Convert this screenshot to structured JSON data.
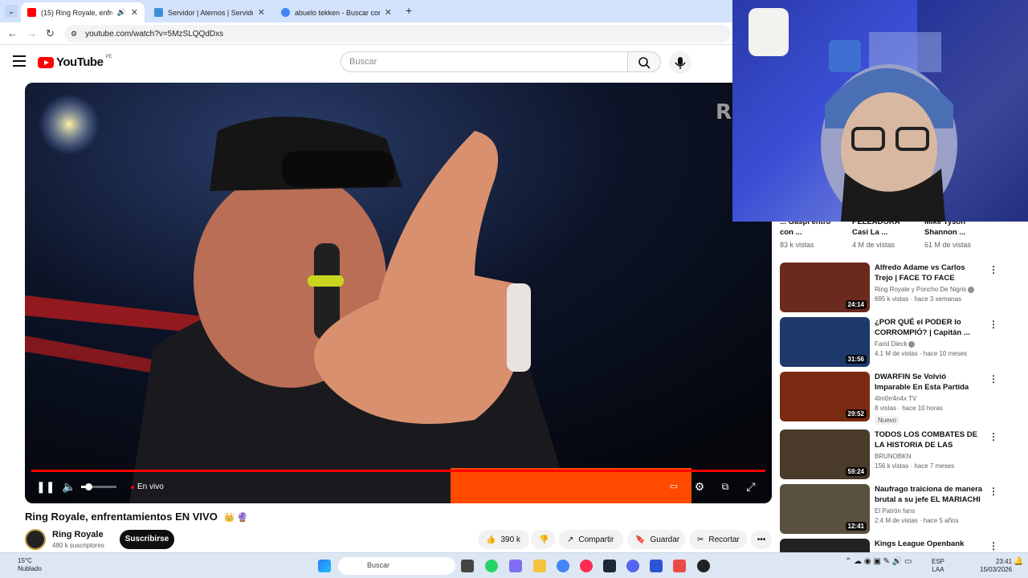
{
  "browser": {
    "tabs": [
      {
        "title": "(15) Ring Royale, enfrentam",
        "favicon_color": "#ff0000"
      },
      {
        "title": "Servidor | Aternos | Servidor de",
        "favicon_color": "#3c8fd6"
      },
      {
        "title": "abuelo tekken - Buscar con Goo",
        "favicon_color": "#4285f4"
      }
    ],
    "url": "youtube.com/watch?v=5MzSLQQdDxs"
  },
  "youtube": {
    "logo": "YouTube",
    "country": "PE",
    "search_placeholder": "Buscar"
  },
  "player": {
    "live_label": "En vivo",
    "progress": 1.0,
    "volume": 0.2
  },
  "video": {
    "title": "Ring Royale, enfrentamientos EN VIVO",
    "title_emoji": "👑 🔮",
    "channel": "Ring Royale",
    "subscribers": "480 k suscriptores",
    "subscribe_label": "Suscribirse",
    "likes": "390 k",
    "share_label": "Compartir",
    "save_label": "Guardar",
    "clip_label": "Recortar"
  },
  "shorts_row": [
    {
      "title": "... Gaspi entró con ...",
      "views": "83 k vistas"
    },
    {
      "title": "PELEADORA Casi La ...",
      "views": "4 M de vistas"
    },
    {
      "title": "Mike Tyson Shannon ...",
      "views": "61 M de vistas"
    }
  ],
  "recommendations": [
    {
      "title": "Alfredo Adame vs Carlos Trejo | FACE TO FACE #RINGROYALE",
      "channel": "Ring Royale y Poncho De Nigris",
      "meta": "695 k vistas · hace 3 semanas",
      "duration": "24:14",
      "color": "#6b2a1e",
      "verified": true,
      "badge": ""
    },
    {
      "title": "¿POR QUÉ el PODER lo CORROMPIÓ? | Capitán ...",
      "channel": "Farid Dieck",
      "meta": "4.1 M de vistas · hace 10 meses",
      "duration": "31:56",
      "color": "#1d3a6b",
      "verified": true,
      "badge": ""
    },
    {
      "title": "DWARFIN Se Volvió Imparable En Esta Partida Noobs Are ...",
      "channel": "4lm0rr4n4x TV",
      "meta": "8 vistas · hace 10 horas",
      "duration": "29:52",
      "color": "#7a2a10",
      "verified": false,
      "badge": "Nuevo"
    },
    {
      "title": "TODOS LOS COMBATES DE LA HISTORIA DE LAS VELADAS - ...",
      "channel": "BRUNOBKN",
      "meta": "156 k vistas · hace 7 meses",
      "duration": "59:24",
      "color": "#4a3a2a",
      "verified": false,
      "badge": ""
    },
    {
      "title": "Naufrago traiciona de manera brutal a su jefe EL MARIACHI |...",
      "channel": "El Patrón fans",
      "meta": "2.4 M de vistas · hace 5 años",
      "duration": "12:41",
      "color": "#5a5040",
      "verified": false,
      "badge": ""
    },
    {
      "title": "Kings League Openbank",
      "channel": "",
      "meta": "",
      "duration": "",
      "color": "#222222",
      "verified": false,
      "badge": ""
    }
  ],
  "taskbar": {
    "weather_temp": "15°C",
    "weather_text": "Nublado",
    "search_label": "Buscar",
    "lang_top": "ESP",
    "lang_bottom": "LAA",
    "time": "23:41",
    "date": "15/03/2026"
  }
}
